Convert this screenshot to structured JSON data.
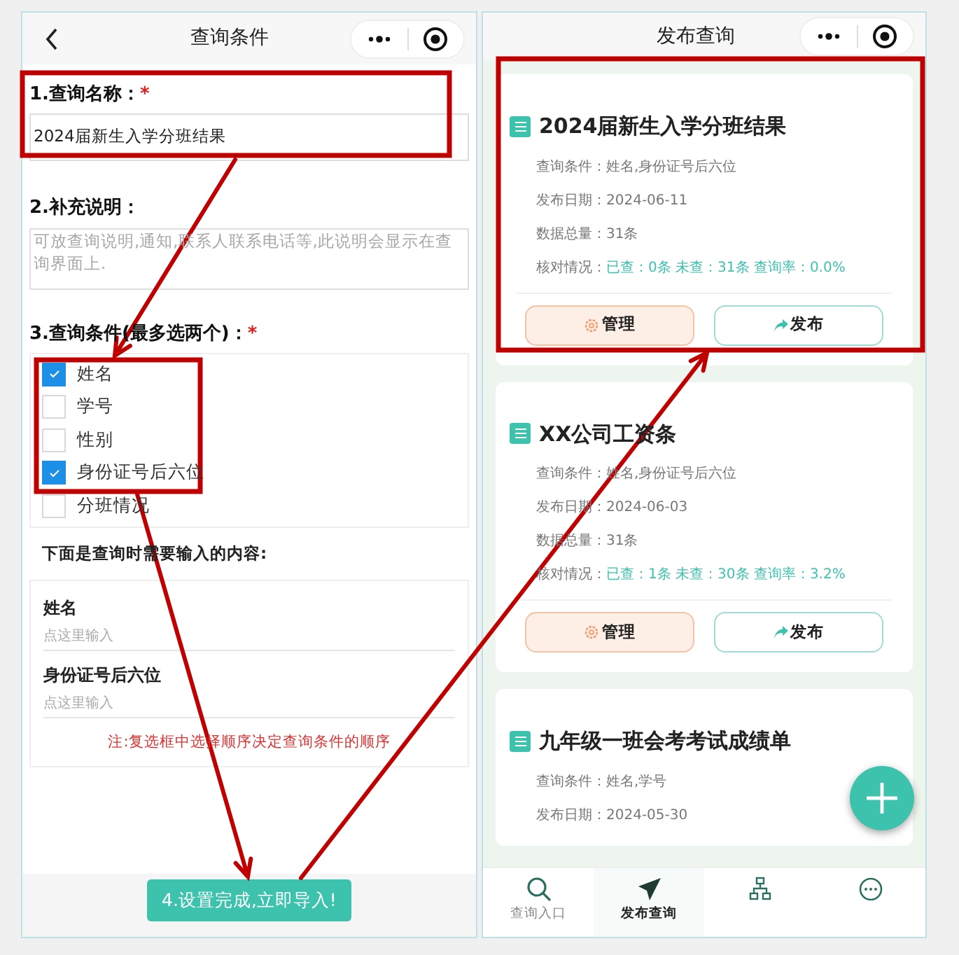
{
  "left": {
    "title": "查询条件",
    "name_field": {
      "label": "1.查询名称：",
      "required_mark": "*",
      "value": "2024届新生入学分班结果"
    },
    "note_field": {
      "label": "2.补充说明：",
      "placeholder": "可放查询说明,通知,联系人联系电话等,此说明会显示在查询界面上."
    },
    "conditions": {
      "label": "3.查询条件(最多选两个)：",
      "required_mark": "*",
      "options": [
        {
          "label": "姓名",
          "checked": true
        },
        {
          "label": "学号",
          "checked": false
        },
        {
          "label": "性别",
          "checked": false
        },
        {
          "label": "身份证号后六位",
          "checked": true
        },
        {
          "label": "分班情况",
          "checked": false
        }
      ]
    },
    "inputs_heading": "下面是查询时需要输入的内容:",
    "inputs": [
      {
        "label": "姓名",
        "placeholder": "点这里输入"
      },
      {
        "label": "身份证号后六位",
        "placeholder": "点这里输入"
      }
    ],
    "hint": "注:复选框中选择顺序决定查询条件的顺序",
    "submit": "4.设置完成,立即导入!"
  },
  "right": {
    "title": "发布查询",
    "cards": [
      {
        "title": "2024届新生入学分班结果",
        "rows": [
          {
            "label": "查询条件：",
            "value": "姓名,身份证号后六位"
          },
          {
            "label": "发布日期：",
            "value": "2024-06-11"
          },
          {
            "label": "数据总量：",
            "value": "31条"
          }
        ],
        "status": {
          "label": "核对情况：",
          "value": "已查：0条 未查：31条 查询率：0.0%"
        },
        "buttons": [
          "管理",
          "发布"
        ]
      },
      {
        "title": "XX公司工资条",
        "rows": [
          {
            "label": "查询条件：",
            "value": "姓名,身份证号后六位"
          },
          {
            "label": "发布日期：",
            "value": "2024-06-03"
          },
          {
            "label": "数据总量：",
            "value": "31条"
          }
        ],
        "status": {
          "label": "核对情况：",
          "value": "已查：1条 未查：30条 查询率：3.2%"
        },
        "buttons": [
          "管理",
          "发布"
        ]
      },
      {
        "title": "九年级一班会考考试成绩单",
        "rows": [
          {
            "label": "查询条件：",
            "value": "姓名,学号"
          },
          {
            "label": "发布日期：",
            "value": "2024-05-30"
          }
        ]
      }
    ],
    "tabs": [
      {
        "kind": "search",
        "label": "查询入口",
        "selected": false
      },
      {
        "kind": "send",
        "label": "发布查询",
        "selected": true
      },
      {
        "kind": "network",
        "selected": false
      },
      {
        "kind": "more",
        "selected": false
      }
    ]
  }
}
